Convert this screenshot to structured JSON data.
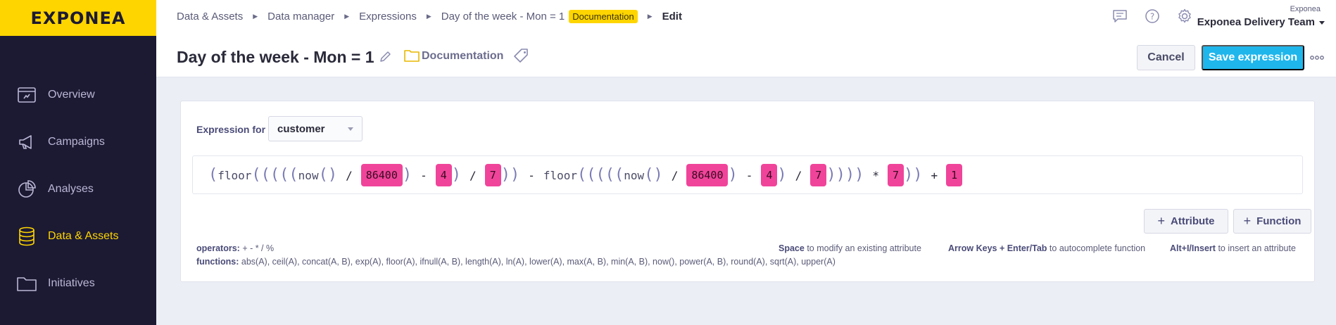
{
  "brand": {
    "logo": "EXPONEA"
  },
  "sidebar": {
    "items": [
      {
        "label": "Overview",
        "icon": "overview-icon",
        "active": false
      },
      {
        "label": "Campaigns",
        "icon": "megaphone-icon",
        "active": false
      },
      {
        "label": "Analyses",
        "icon": "pie-chart-icon",
        "active": false
      },
      {
        "label": "Data & Assets",
        "icon": "database-icon",
        "active": true
      },
      {
        "label": "Initiatives",
        "icon": "folder-icon",
        "active": false
      }
    ]
  },
  "breadcrumb": {
    "items": [
      "Data & Assets",
      "Data manager",
      "Expressions",
      "Day of the week - Mon = 1"
    ],
    "badge": "Documentation",
    "current": "Edit"
  },
  "page": {
    "title": "Day of the week - Mon = 1",
    "folder": "Documentation"
  },
  "account": {
    "company": "Exponea",
    "team": "Exponea Delivery Team"
  },
  "actions": {
    "cancel": "Cancel",
    "save": "Save expression"
  },
  "editor": {
    "label": "Expression for",
    "target": "customer",
    "tokens": [
      {
        "t": "p",
        "v": "("
      },
      {
        "t": "f",
        "v": "floor"
      },
      {
        "t": "p",
        "v": "("
      },
      {
        "t": "p",
        "v": "("
      },
      {
        "t": "p",
        "v": "("
      },
      {
        "t": "p",
        "v": "("
      },
      {
        "t": "p",
        "v": "("
      },
      {
        "t": "f",
        "v": "now"
      },
      {
        "t": "p",
        "v": "("
      },
      {
        "t": "p",
        "v": ")"
      },
      {
        "t": "o",
        "v": "/"
      },
      {
        "t": "n",
        "v": "86400"
      },
      {
        "t": "p",
        "v": ")"
      },
      {
        "t": "o",
        "v": "-"
      },
      {
        "t": "n",
        "v": "4"
      },
      {
        "t": "p",
        "v": ")"
      },
      {
        "t": "o",
        "v": "/"
      },
      {
        "t": "n",
        "v": "7"
      },
      {
        "t": "p",
        "v": ")"
      },
      {
        "t": "p",
        "v": ")"
      },
      {
        "t": "o",
        "v": "-"
      },
      {
        "t": "f",
        "v": "floor"
      },
      {
        "t": "p",
        "v": "("
      },
      {
        "t": "p",
        "v": "("
      },
      {
        "t": "p",
        "v": "("
      },
      {
        "t": "p",
        "v": "("
      },
      {
        "t": "p",
        "v": "("
      },
      {
        "t": "f",
        "v": "now"
      },
      {
        "t": "p",
        "v": "("
      },
      {
        "t": "p",
        "v": ")"
      },
      {
        "t": "o",
        "v": "/"
      },
      {
        "t": "n",
        "v": "86400"
      },
      {
        "t": "p",
        "v": ")"
      },
      {
        "t": "o",
        "v": "-"
      },
      {
        "t": "n",
        "v": "4"
      },
      {
        "t": "p",
        "v": ")"
      },
      {
        "t": "o",
        "v": "/"
      },
      {
        "t": "n",
        "v": "7"
      },
      {
        "t": "p",
        "v": ")"
      },
      {
        "t": "p",
        "v": ")"
      },
      {
        "t": "p",
        "v": ")"
      },
      {
        "t": "p",
        "v": ")"
      },
      {
        "t": "o",
        "v": "*"
      },
      {
        "t": "n",
        "v": "7"
      },
      {
        "t": "p",
        "v": ")"
      },
      {
        "t": "p",
        "v": ")"
      },
      {
        "t": "o",
        "v": "+"
      },
      {
        "t": "n",
        "v": "1"
      }
    ],
    "add_attribute": "Attribute",
    "add_function": "Function",
    "help": {
      "operators_label": "operators:",
      "operators": "+ - * / %",
      "functions_label": "functions:",
      "functions": "abs(A), ceil(A), concat(A, B), exp(A), floor(A), ifnull(A, B), length(A), ln(A), lower(A), max(A, B), min(A, B), now(), power(A, B), round(A), sqrt(A), upper(A)",
      "hint1_key": "Space",
      "hint1_text": "to modify an existing attribute",
      "hint2_key": "Arrow Keys + Enter/Tab",
      "hint2_text": "to autocomplete function",
      "hint3_key": "Alt+I/Insert",
      "hint3_text": "to insert an attribute"
    }
  },
  "colors": {
    "brand_yellow": "#ffd500",
    "sidebar_bg": "#1c1a33",
    "primary": "#1fb6ec",
    "number_token": "#f0449a"
  }
}
